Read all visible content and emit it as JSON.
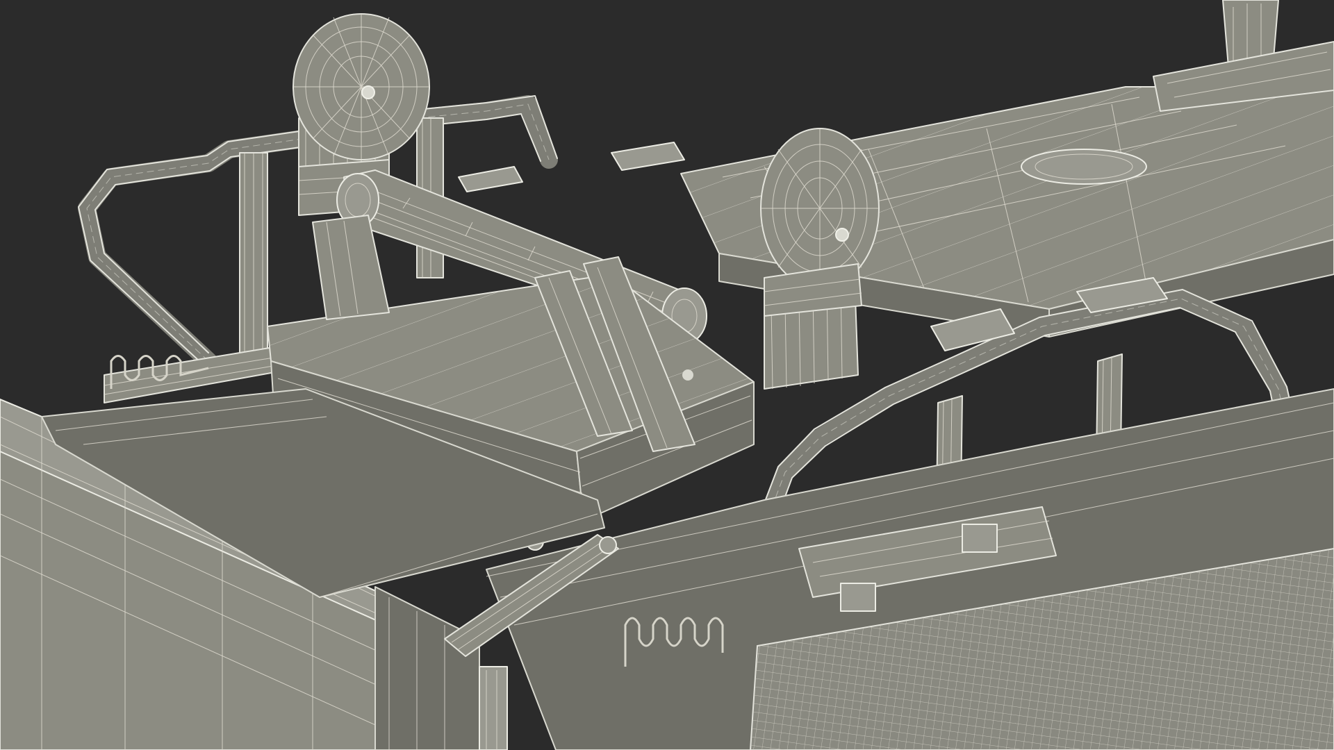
{
  "scene": {
    "background_color": "#2b2b2b",
    "material_color": "#8c8c82",
    "wireframe_color": "#e4e4dc"
  }
}
